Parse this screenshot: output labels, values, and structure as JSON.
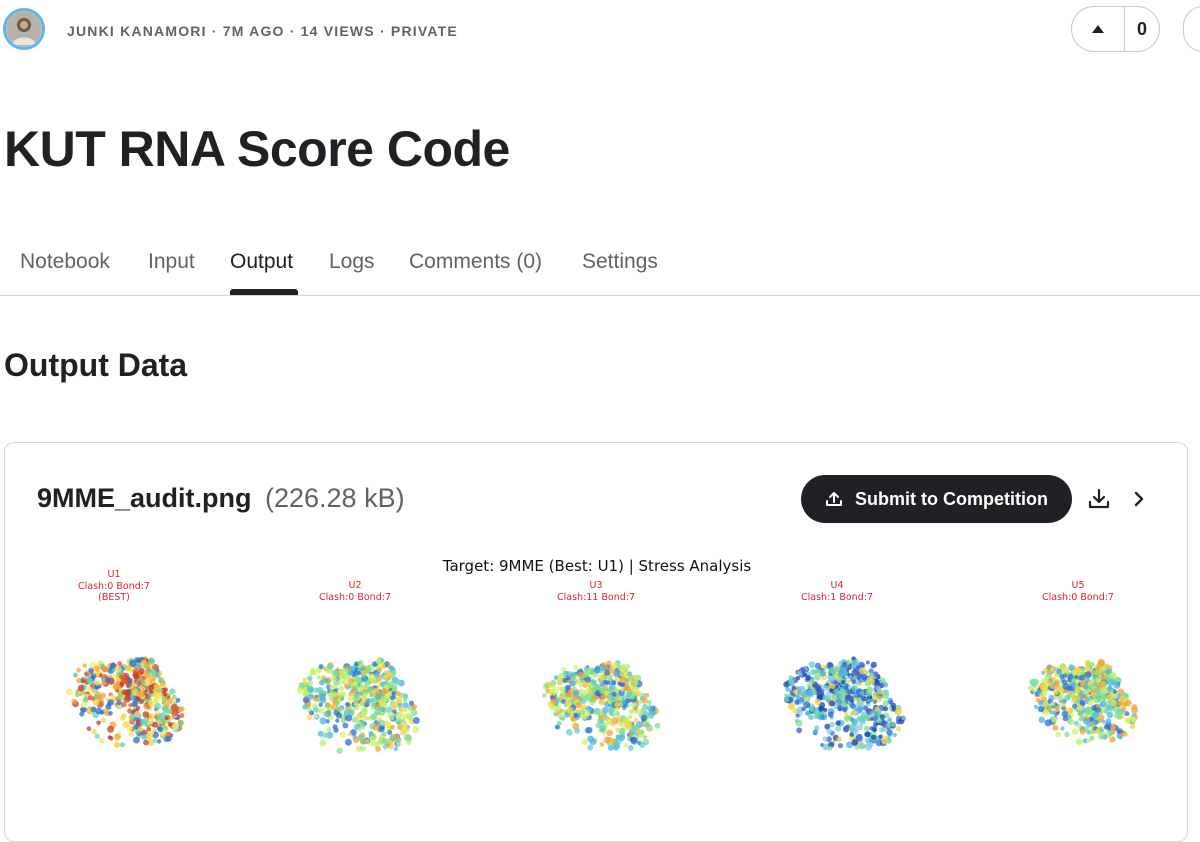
{
  "header": {
    "meta": "JUNKI KANAMORI · 7M AGO · 14 VIEWS · PRIVATE",
    "vote_count": "0"
  },
  "title": "KUT RNA Score Code",
  "tabs": [
    {
      "label": "Notebook"
    },
    {
      "label": "Input"
    },
    {
      "label": "Output",
      "active": true
    },
    {
      "label": "Logs"
    },
    {
      "label": "Comments (0)"
    },
    {
      "label": "Settings"
    }
  ],
  "section_heading": "Output Data",
  "file": {
    "name": "9MME_audit.png",
    "size": "(226.28 kB)",
    "submit_label": "Submit to Competition"
  },
  "figure": {
    "title": "Target: 9MME (Best: U1) | Stress Analysis",
    "panels": [
      {
        "name": "U1",
        "stats": "Clash:0 Bond:7",
        "note": "(BEST)",
        "tone": "warm"
      },
      {
        "name": "U2",
        "stats": "Clash:0 Bond:7",
        "note": "",
        "tone": "mixed"
      },
      {
        "name": "U3",
        "stats": "Clash:11 Bond:7",
        "note": "",
        "tone": "mixed"
      },
      {
        "name": "U4",
        "stats": "Clash:1 Bond:7",
        "note": "",
        "tone": "cool"
      },
      {
        "name": "U5",
        "stats": "Clash:0 Bond:7",
        "note": "",
        "tone": "mixed"
      }
    ]
  },
  "colors": {
    "accent_dark": "#202124",
    "muted_text": "#5f6368",
    "avatar_ring": "#5fb3e6",
    "panel_label": "#d62728"
  }
}
